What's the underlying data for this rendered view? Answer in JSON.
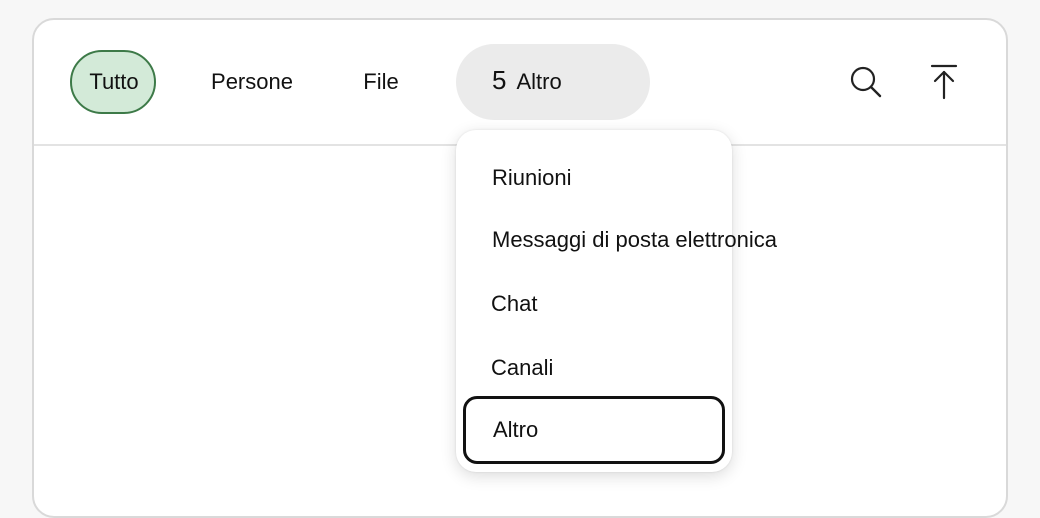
{
  "tabs": {
    "all": "Tutto",
    "people": "Persone",
    "files": "File",
    "more_count": "5",
    "more_label": "Altro"
  },
  "icons": {
    "search": "search-icon",
    "collapse": "arrow-up-to-top-icon"
  },
  "menu": {
    "items": [
      "Riunioni",
      "Messaggi di posta elettronica",
      "Chat",
      "Canali",
      "Altro"
    ],
    "focused_index": 4
  },
  "colors": {
    "selected_tab_fill": "#d3ead8",
    "selected_tab_border": "#3d7a48",
    "more_tab_fill": "#ebebeb",
    "focus_outline": "#111111"
  }
}
